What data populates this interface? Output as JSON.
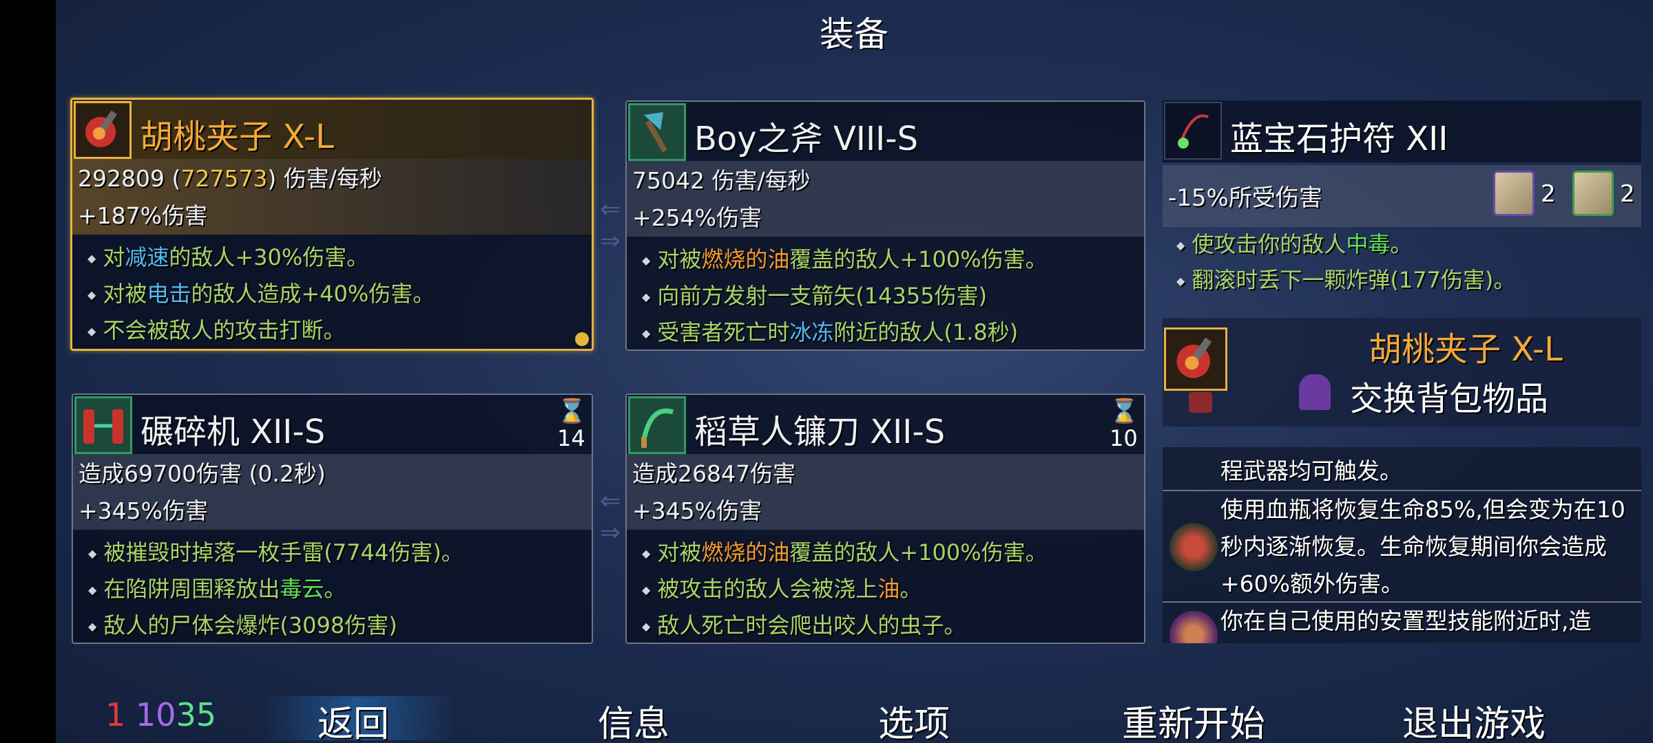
{
  "screen_title": "装备",
  "weapons": [
    {
      "name": "胡桃夹子 X-L",
      "dps_value": "292809",
      "dps_bonus_value": "727573",
      "dps_suffix": "伤害/每秒",
      "bonus": "+187%伤害",
      "effects": [
        {
          "pre": "对",
          "key": "减速",
          "post": "的敌人+30%伤害。"
        },
        {
          "pre": "对被",
          "key": "电击",
          "post": "的敌人造成+40%伤害。"
        },
        {
          "pre": "",
          "key": "",
          "post": "不会被敌人的攻击打断。"
        }
      ]
    },
    {
      "name": "Boy之斧 VIII-S",
      "dps_line": "75042 伤害/每秒",
      "bonus": "+254%伤害",
      "effects": [
        {
          "pre": "对被",
          "key": "燃烧的油",
          "post": "覆盖的敌人+100%伤害。"
        },
        {
          "pre": "",
          "key": "",
          "post": "向前方发射一支箭矢(14355伤害)"
        },
        {
          "pre": "受害者死亡时",
          "key": "冰冻",
          "post": "附近的敌人(1.8秒)"
        }
      ]
    },
    {
      "name": "碾碎机 XII-S",
      "dps_line": "造成69700伤害 (0.2秒)",
      "bonus": "+345%伤害",
      "cooldown": "14",
      "effects": [
        {
          "pre": "",
          "key": "",
          "post": "被摧毁时掉落一枚手雷(7744伤害)。"
        },
        {
          "pre": "在陷阱周围释放出",
          "key": "毒云",
          "post": "。"
        },
        {
          "pre": "",
          "key": "",
          "post": "敌人的尸体会爆炸(3098伤害)"
        }
      ]
    },
    {
      "name": "稻草人镰刀 XII-S",
      "dps_line": "造成26847伤害",
      "bonus": "+345%伤害",
      "cooldown": "10",
      "effects": [
        {
          "pre": "对被",
          "key": "燃烧的油",
          "post": "覆盖的敌人+100%伤害。"
        },
        {
          "pre": "被攻击的敌人会被浇上",
          "key": "油",
          "post": "。"
        },
        {
          "pre": "",
          "key": "",
          "post": "敌人死亡时会爬出咬人的虫子。"
        }
      ]
    }
  ],
  "amulet": {
    "name": "蓝宝石护符 XII",
    "stat": "-15%所受伤害",
    "scroll_purple_count": "2",
    "scroll_green_count": "2",
    "effects": [
      {
        "pre": "使攻击你的敌人",
        "key": "中毒",
        "post": "。"
      },
      {
        "pre": "",
        "key": "",
        "post": "翻滚时丢下一颗炸弹(177伤害)。"
      }
    ]
  },
  "swap_panel": {
    "item_name": "胡桃夹子 X-L",
    "action_label": "交换背包物品"
  },
  "effects_list": [
    {
      "text": "程武器均可触发。"
    },
    {
      "text": "使用血瓶将恢复生命85%,但会变为在10秒内逐渐恢复。生命恢复期间你会造成+60%额外伤害。"
    },
    {
      "text": "你在自己使用的安置型技能附近时,造"
    }
  ],
  "currency": {
    "red": "1",
    "purple": "10",
    "green": "35"
  },
  "bottom_menu": {
    "back": "返回",
    "info": "信息",
    "options": "选项",
    "restart": "重新开始",
    "quit": "退出游戏"
  },
  "colors": {
    "selected_border": "#e7b440",
    "item_name_orange": "#f3a93a",
    "effect_green": "#a9d36a",
    "keyword_blue": "#55b8f0",
    "keyword_orange": "#f39a2e",
    "keyword_green": "#63e05a"
  }
}
